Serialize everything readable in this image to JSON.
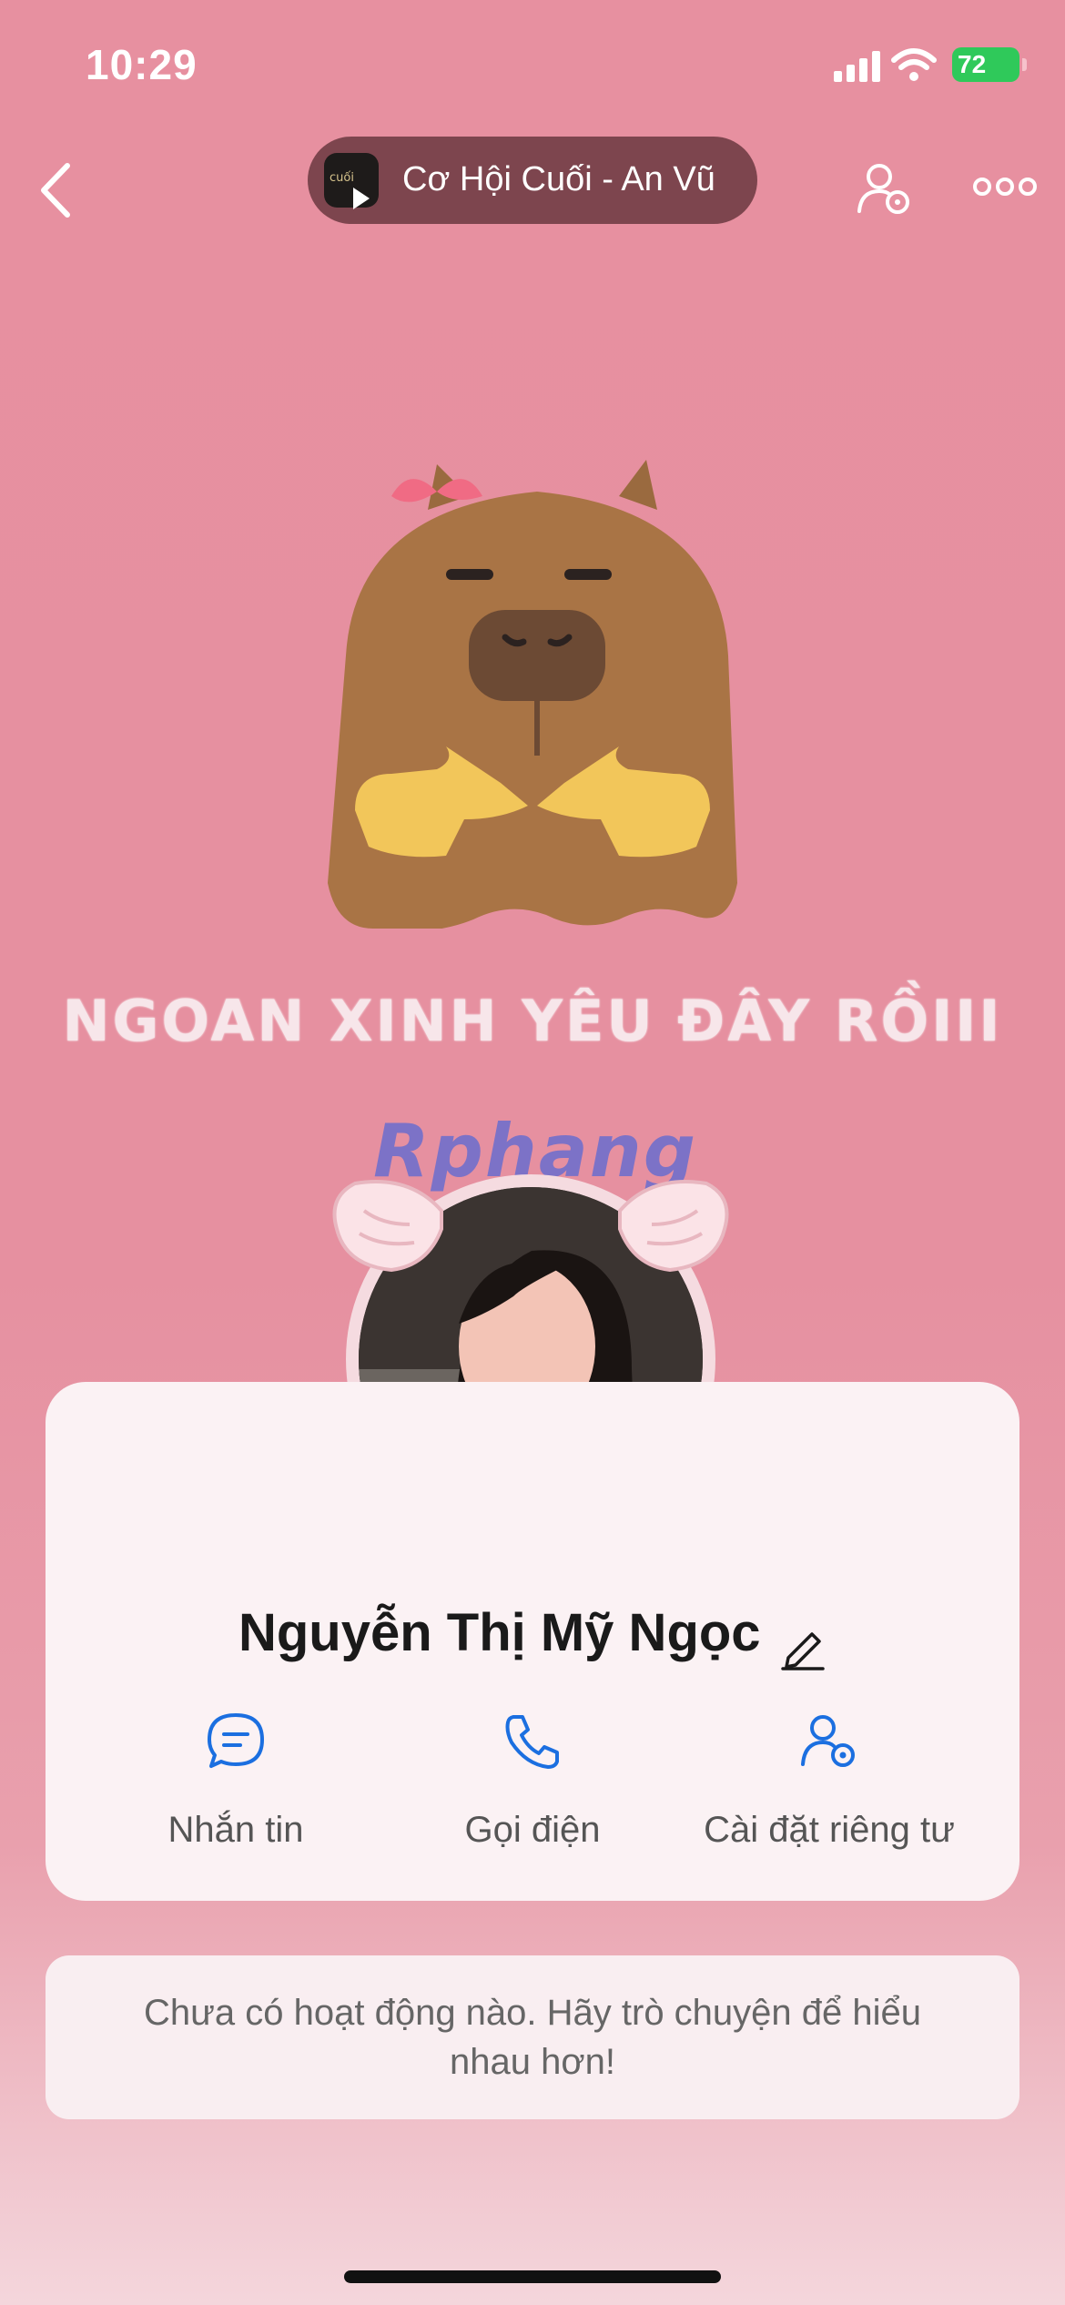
{
  "status_bar": {
    "time": "10:29",
    "battery": "72",
    "icons": [
      "signal-icon",
      "wifi-icon",
      "battery-icon"
    ]
  },
  "nav": {
    "back_icon": "chevron-left-icon",
    "song_title": "Cơ Hội Cuối - An Vũ",
    "song_thumb_text": "cuối",
    "settings_icon": "user-gear-icon",
    "more_icon": "more-dots-icon"
  },
  "cover": {
    "caption": "NGOAN XINH YÊU ĐÂY RỒIII"
  },
  "watermark": "Rphang",
  "profile": {
    "name": "Nguyễn Thị Mỹ Ngọc",
    "edit_icon": "pencil-icon"
  },
  "actions": [
    {
      "label": "Nhắn tin",
      "icon": "message-icon"
    },
    {
      "label": "Gọi điện",
      "icon": "phone-icon"
    },
    {
      "label": "Cài đặt riêng tư",
      "icon": "user-gear-icon"
    }
  ],
  "activity": {
    "empty_text": "Chưa có hoạt động nào. Hãy trò chuyện để hiểu nhau hơn!"
  },
  "colors": {
    "background": "#e790a0",
    "accent": "#1b6fe0",
    "card": "#fbf2f4"
  }
}
